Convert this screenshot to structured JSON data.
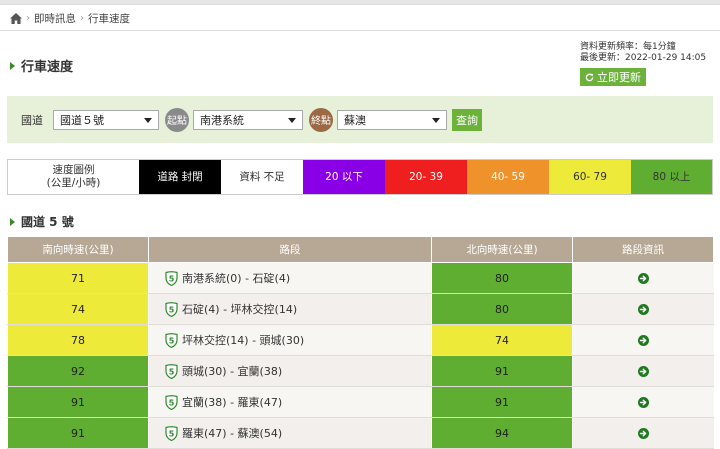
{
  "breadcrumb": {
    "items": [
      "即時訊息",
      "行車速度"
    ]
  },
  "page_title": "行車速度",
  "update": {
    "frequency": "資料更新頻率：每1分鐘",
    "last": "最後更新：2022-01-29 14:05",
    "refresh_label": "立即更新"
  },
  "filter": {
    "road_label": "國道",
    "road_value": "國道５號",
    "start_badge": "起點",
    "start_value": "南港系統",
    "end_badge": "終點",
    "end_value": "蘇澳",
    "query_label": "查詢"
  },
  "legend": {
    "title_line1": "速度圖例",
    "title_line2": "(公里/小時)",
    "items": [
      {
        "label": "道路 封閉",
        "bg": "#000000",
        "fg": "#ffffff"
      },
      {
        "label": "資料 不足",
        "bg": "#ffffff",
        "fg": "#333333"
      },
      {
        "label": "20 以下",
        "bg": "#8a00e6",
        "fg": "#ffffff"
      },
      {
        "label": "20- 39",
        "bg": "#ef1f1f",
        "fg": "#ffffff"
      },
      {
        "label": "40- 59",
        "bg": "#f0922a",
        "fg": "#ffffff"
      },
      {
        "label": "60- 79",
        "bg": "#eeea3a",
        "fg": "#333333"
      },
      {
        "label": "80 以上",
        "bg": "#5fae31",
        "fg": "#333333"
      }
    ]
  },
  "section_title": "國道 5 號",
  "table": {
    "headers": [
      "南向時速(公里)",
      "路段",
      "北向時速(公里)",
      "路段資訊"
    ],
    "rows": [
      {
        "south": "71",
        "south_color": "#eeea3a",
        "route": "南港系統(0) - 石碇(4)",
        "north": "80",
        "north_color": "#5fae31"
      },
      {
        "south": "74",
        "south_color": "#eeea3a",
        "route": "石碇(4) - 坪林交控(14)",
        "north": "80",
        "north_color": "#5fae31"
      },
      {
        "south": "78",
        "south_color": "#eeea3a",
        "route": "坪林交控(14) - 頭城(30)",
        "north": "74",
        "north_color": "#eeea3a"
      },
      {
        "south": "92",
        "south_color": "#5fae31",
        "route": "頭城(30) - 宜蘭(38)",
        "north": "91",
        "north_color": "#5fae31"
      },
      {
        "south": "91",
        "south_color": "#5fae31",
        "route": "宜蘭(38) - 羅東(47)",
        "north": "91",
        "north_color": "#5fae31"
      },
      {
        "south": "91",
        "south_color": "#5fae31",
        "route": "羅東(47) - 蘇澳(54)",
        "north": "94",
        "north_color": "#5fae31"
      }
    ]
  },
  "icons": {
    "home": "home-icon",
    "refresh": "refresh-icon",
    "route_shield": "freeway-5-shield-icon",
    "detail": "arrow-circle-right-icon"
  },
  "colors": {
    "accent": "#6cb23a",
    "header": "#b7a896",
    "filter_bg": "#e7f0d9",
    "start_badge": "#8a8a8a",
    "end_badge": "#9b6a44"
  }
}
